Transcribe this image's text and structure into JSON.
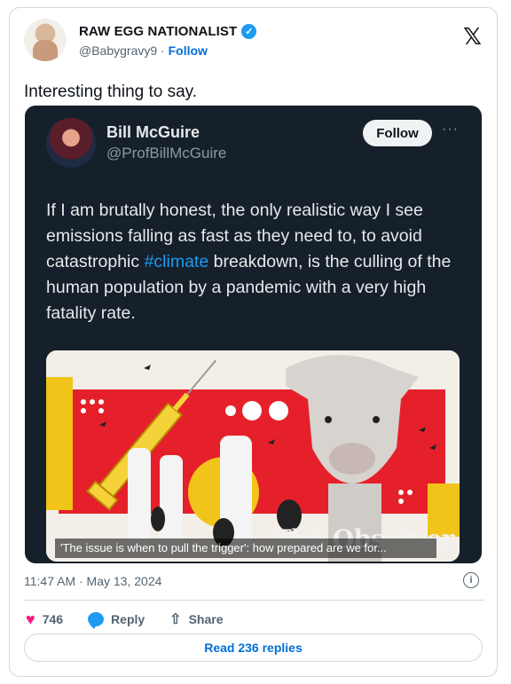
{
  "author": {
    "name": "RAW EGG NATIONALIST",
    "handle": "@Babygravy9",
    "separator": "·",
    "follow_label": "Follow"
  },
  "tweet_text": "Interesting thing to say.",
  "embedded": {
    "name": "Bill McGuire",
    "handle": "@ProfBillMcGuire",
    "follow_label": "Follow",
    "more_label": "···",
    "text_before": "If I am brutally honest, the only realistic way I see emissions falling as fast as they need to, to avoid catastrophic ",
    "hashtag": "#climate",
    "text_after": " breakdown, is the culling of the human population by a pandemic with a very high fatality rate.",
    "media": {
      "brand": "The Observer",
      "caption": "'The issue is when to pull the trigger': how prepared are we for..."
    }
  },
  "timestamp": "11:47 AM · May 13, 2024",
  "actions": {
    "likes": "746",
    "reply_label": "Reply",
    "share_label": "Share"
  },
  "read_replies_label": "Read 236 replies",
  "colors": {
    "accent": "#1d9bf0",
    "link": "#006fd6",
    "like": "#f91880",
    "embed_bg": "#15202b"
  }
}
